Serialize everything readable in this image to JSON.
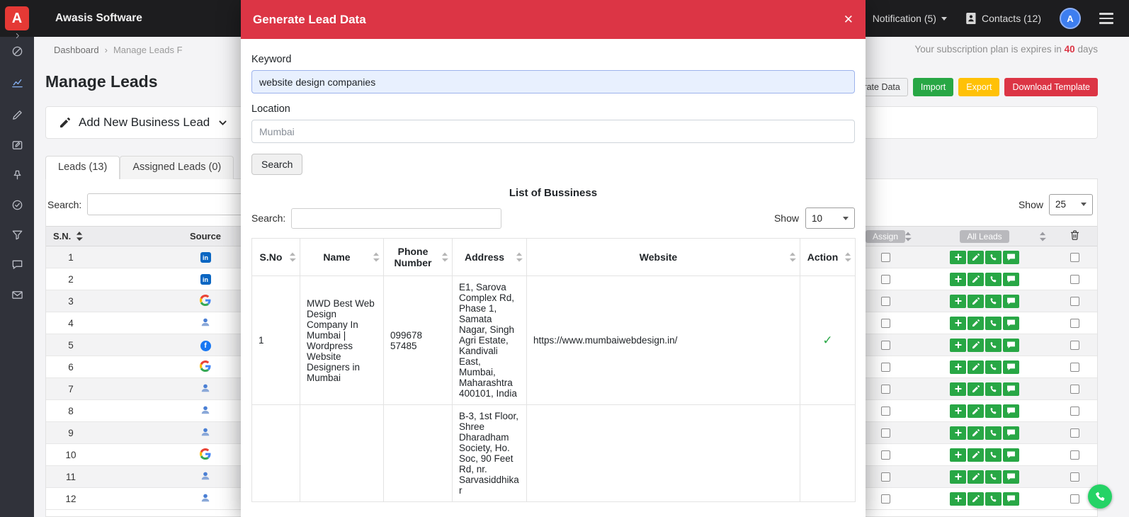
{
  "app": {
    "name": "Awasis Software",
    "logo_letter": "A"
  },
  "navbar": {
    "notification_label": "Notification (5)",
    "contacts_label": "Contacts (12)",
    "avatar_letter": "A"
  },
  "sidebar": {
    "icons": [
      "chevron-right-icon",
      "slash-circle-icon",
      "analytics-icon",
      "pencil-icon",
      "message-edit-icon",
      "pin-icon",
      "check-circle-icon",
      "filter-icon",
      "chat-icon",
      "mail-icon"
    ]
  },
  "page": {
    "breadcrumb": {
      "home": "Dashboard",
      "sep": "›",
      "current": "Manage Leads F"
    },
    "subscription": {
      "prefix": "Your subscription plan is expires in",
      "days": "40",
      "suffix": "days"
    },
    "title": "Manage Leads",
    "add_panel_label": "Add New Business Lead",
    "tabs": [
      "Leads (13)",
      "Assigned Leads (0)"
    ],
    "toolbar": {
      "generate": "Generate Data",
      "import": "Import",
      "export": "Export",
      "download": "Download Template"
    },
    "search_label": "Search:",
    "show_label": "Show",
    "page_size": "25",
    "table": {
      "sn_header": "S.N.",
      "source_header": "Source",
      "assign_header": "Assign",
      "all_leads_header": "All Leads",
      "row_actions": [
        "add-icon",
        "edit-icon",
        "call-icon",
        "sms-icon"
      ],
      "rows": [
        {
          "sn": "1",
          "source": "linkedin"
        },
        {
          "sn": "2",
          "source": "linkedin"
        },
        {
          "sn": "3",
          "source": "google"
        },
        {
          "sn": "4",
          "source": "person"
        },
        {
          "sn": "5",
          "source": "facebook"
        },
        {
          "sn": "6",
          "source": "google"
        },
        {
          "sn": "7",
          "source": "person"
        },
        {
          "sn": "8",
          "source": "person"
        },
        {
          "sn": "9",
          "source": "person"
        },
        {
          "sn": "10",
          "source": "google"
        },
        {
          "sn": "11",
          "source": "person"
        },
        {
          "sn": "12",
          "source": "person"
        }
      ]
    }
  },
  "modal": {
    "title": "Generate Lead Data",
    "close_icon": "✕",
    "keyword": {
      "label": "Keyword",
      "value": "website design companies"
    },
    "location": {
      "label": "Location",
      "value": "Mumbai"
    },
    "search_button": "Search",
    "list_title": "List of Bussiness",
    "search_label": "Search:",
    "show_label": "Show",
    "page_size": "10",
    "table": {
      "headers": [
        "S.No",
        "Name",
        "Phone Number",
        "Address",
        "Website",
        "Action"
      ],
      "rows": [
        {
          "sno": "1",
          "name": "MWD Best Web Design Company In Mumbai | Wordpress Website Designers in Mumbai",
          "phone": "099678 57485",
          "address": "E1, Sarova Complex Rd, Phase 1, Samata Nagar, Singh Agri Estate, Kandivali East, Mumbai, Maharashtra 400101, India",
          "website": "https://www.mumbaiwebdesign.in/",
          "action": "check"
        },
        {
          "sno": "",
          "name": "",
          "phone": "",
          "address": "B-3, 1st Floor, Shree Dharadham Society, Ho. Soc, 90 Feet Rd, nr. Sarvasiddhikar",
          "website": "",
          "action": ""
        }
      ]
    }
  },
  "colors": {
    "danger": "#dc3545",
    "success": "#28a745",
    "warning": "#ffc107",
    "linkedin": "#0a66c2",
    "facebook": "#1877f2",
    "whatsapp": "#25d366",
    "autofill_bg": "#e8f0fe"
  }
}
